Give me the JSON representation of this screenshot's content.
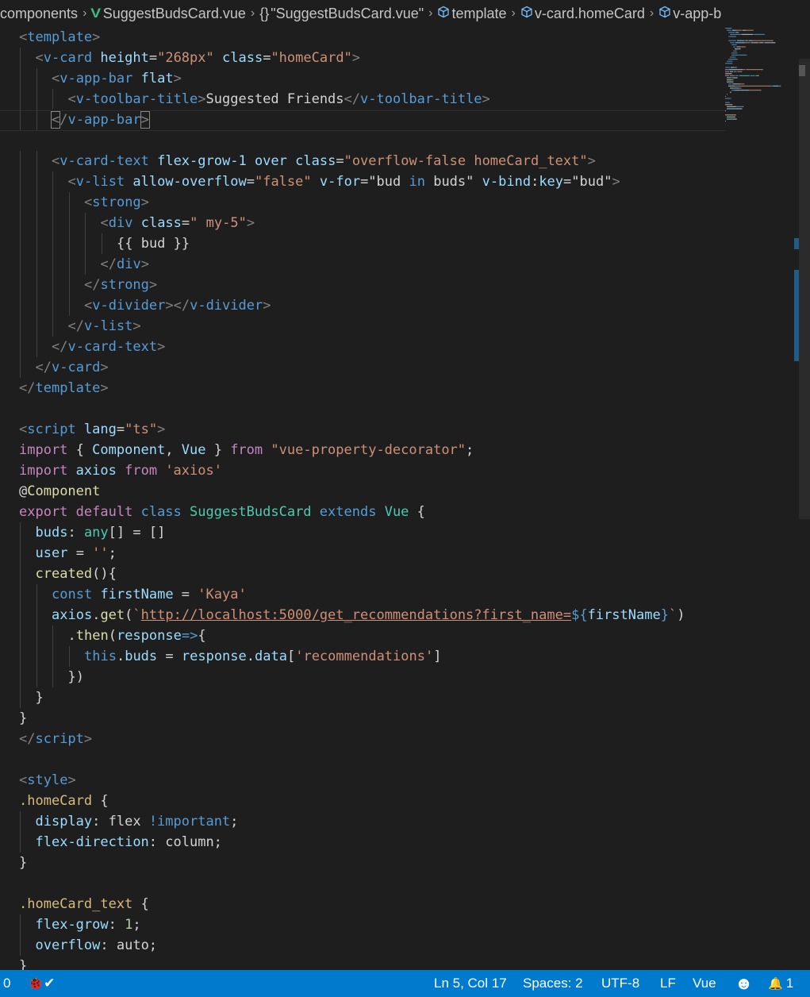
{
  "breadcrumb": {
    "items": [
      "components",
      "SuggestBudsCard.vue",
      "\"SuggestBudsCard.vue\"",
      "template",
      "v-card.homeCard",
      "v-app-b"
    ],
    "brace_glyph": "{}",
    "vue_glyph": "V",
    "chevron_glyph": "›",
    "icons": [
      "vue-file-icon",
      "braces-icon",
      "cube-icon",
      "cube-icon",
      "cube-icon"
    ]
  },
  "code_lines": [
    [
      [
        0,
        "tg",
        "<"
      ],
      [
        0,
        "tn",
        "template"
      ],
      [
        0,
        "tg",
        ">"
      ]
    ],
    [
      [
        1,
        "tg",
        "<"
      ],
      [
        1,
        "tn",
        "v-card"
      ],
      [
        1,
        "tx",
        " "
      ],
      [
        1,
        "at",
        "height"
      ],
      [
        1,
        "tx",
        "="
      ],
      [
        1,
        "sv",
        "\"268px\""
      ],
      [
        1,
        "tx",
        " "
      ],
      [
        1,
        "at",
        "class"
      ],
      [
        1,
        "tx",
        "="
      ],
      [
        1,
        "sv",
        "\"homeCard\""
      ],
      [
        1,
        "tg",
        ">"
      ]
    ],
    [
      [
        2,
        "tg",
        "<"
      ],
      [
        2,
        "tn",
        "v-app-bar"
      ],
      [
        2,
        "tx",
        " "
      ],
      [
        2,
        "at",
        "flat"
      ],
      [
        2,
        "tg",
        ">"
      ]
    ],
    [
      [
        3,
        "tg",
        "<"
      ],
      [
        3,
        "tn",
        "v-toolbar-title"
      ],
      [
        3,
        "tg",
        ">"
      ],
      [
        3,
        "tx",
        "Suggested Friends"
      ],
      [
        3,
        "tg",
        "</"
      ],
      [
        3,
        "tn",
        "v-toolbar-title"
      ],
      [
        3,
        "tg",
        ">"
      ]
    ],
    [
      [
        2,
        "tg bm",
        "<"
      ],
      [
        2,
        "tg",
        "/"
      ],
      [
        2,
        "tn",
        "v-app-bar"
      ],
      [
        2,
        "tg bm",
        ">"
      ]
    ],
    [],
    [
      [
        2,
        "tg",
        "<"
      ],
      [
        2,
        "tn",
        "v-card-text"
      ],
      [
        2,
        "tx",
        " "
      ],
      [
        2,
        "at",
        "flex-grow-1"
      ],
      [
        2,
        "tx",
        " "
      ],
      [
        2,
        "at",
        "over"
      ],
      [
        2,
        "tx",
        " "
      ],
      [
        2,
        "at",
        "class"
      ],
      [
        2,
        "tx",
        "="
      ],
      [
        2,
        "sv",
        "\"overflow-false homeCard_text\""
      ],
      [
        2,
        "tg",
        ">"
      ]
    ],
    [
      [
        3,
        "tg",
        "<"
      ],
      [
        3,
        "tn",
        "v-list"
      ],
      [
        3,
        "tx",
        " "
      ],
      [
        3,
        "at",
        "allow-overflow"
      ],
      [
        3,
        "tx",
        "="
      ],
      [
        3,
        "sv",
        "\"false\""
      ],
      [
        3,
        "tx",
        " "
      ],
      [
        3,
        "at",
        "v-for"
      ],
      [
        3,
        "tx",
        "=\"bud "
      ],
      [
        3,
        "kw",
        "in"
      ],
      [
        3,
        "tx",
        " buds\""
      ],
      [
        3,
        "tx",
        " "
      ],
      [
        3,
        "at",
        "v-bind"
      ],
      [
        3,
        "tx",
        ":"
      ],
      [
        3,
        "at",
        "key"
      ],
      [
        3,
        "tx",
        "=\"bud\""
      ],
      [
        3,
        "tg",
        ">"
      ]
    ],
    [
      [
        4,
        "tg",
        "<"
      ],
      [
        4,
        "tn",
        "strong"
      ],
      [
        4,
        "tg",
        ">"
      ]
    ],
    [
      [
        5,
        "tg",
        "<"
      ],
      [
        5,
        "tn",
        "div"
      ],
      [
        5,
        "tx",
        " "
      ],
      [
        5,
        "at",
        "class"
      ],
      [
        5,
        "tx",
        "="
      ],
      [
        5,
        "sv",
        "\" my-5\""
      ],
      [
        5,
        "tg",
        ">"
      ]
    ],
    [
      [
        6,
        "tx",
        "{{ bud }}"
      ]
    ],
    [
      [
        5,
        "tg",
        "</"
      ],
      [
        5,
        "tn",
        "div"
      ],
      [
        5,
        "tg",
        ">"
      ]
    ],
    [
      [
        4,
        "tg",
        "</"
      ],
      [
        4,
        "tn",
        "strong"
      ],
      [
        4,
        "tg",
        ">"
      ]
    ],
    [
      [
        4,
        "tg",
        "<"
      ],
      [
        4,
        "tn",
        "v-divider"
      ],
      [
        4,
        "tg",
        "></"
      ],
      [
        4,
        "tn",
        "v-divider"
      ],
      [
        4,
        "tg",
        ">"
      ]
    ],
    [
      [
        3,
        "tg",
        "</"
      ],
      [
        3,
        "tn",
        "v-list"
      ],
      [
        3,
        "tg",
        ">"
      ]
    ],
    [
      [
        2,
        "tg",
        "</"
      ],
      [
        2,
        "tn",
        "v-card-text"
      ],
      [
        2,
        "tg",
        ">"
      ]
    ],
    [
      [
        1,
        "tg",
        "</"
      ],
      [
        1,
        "tn",
        "v-card"
      ],
      [
        1,
        "tg",
        ">"
      ]
    ],
    [
      [
        0,
        "tg",
        "</"
      ],
      [
        0,
        "tn",
        "template"
      ],
      [
        0,
        "tg",
        ">"
      ]
    ],
    [],
    [
      [
        0,
        "tg",
        "<"
      ],
      [
        0,
        "tn",
        "script"
      ],
      [
        0,
        "tx",
        " "
      ],
      [
        0,
        "at",
        "lang"
      ],
      [
        0,
        "tx",
        "="
      ],
      [
        0,
        "sv",
        "\"ts\""
      ],
      [
        0,
        "tg",
        ">"
      ]
    ],
    [
      [
        0,
        "ctl",
        "import"
      ],
      [
        0,
        "tx",
        " { "
      ],
      [
        0,
        "vr",
        "Component"
      ],
      [
        0,
        "tx",
        ", "
      ],
      [
        0,
        "vr",
        "Vue"
      ],
      [
        0,
        "tx",
        " } "
      ],
      [
        0,
        "ctl",
        "from"
      ],
      [
        0,
        "tx",
        " "
      ],
      [
        0,
        "sv",
        "\"vue-property-decorator\""
      ],
      [
        0,
        "tx",
        ";"
      ]
    ],
    [
      [
        0,
        "ctl",
        "import"
      ],
      [
        0,
        "tx",
        " "
      ],
      [
        0,
        "vr",
        "axios"
      ],
      [
        0,
        "tx",
        " "
      ],
      [
        0,
        "ctl",
        "from"
      ],
      [
        0,
        "tx",
        " "
      ],
      [
        0,
        "sv",
        "'axios'"
      ]
    ],
    [
      [
        0,
        "tx",
        "@"
      ],
      [
        0,
        "fn",
        "Component"
      ]
    ],
    [
      [
        0,
        "ctl",
        "export"
      ],
      [
        0,
        "tx",
        " "
      ],
      [
        0,
        "ctl",
        "default"
      ],
      [
        0,
        "tx",
        " "
      ],
      [
        0,
        "kw",
        "class"
      ],
      [
        0,
        "tx",
        " "
      ],
      [
        0,
        "cls",
        "SuggestBudsCard"
      ],
      [
        0,
        "tx",
        " "
      ],
      [
        0,
        "kw",
        "extends"
      ],
      [
        0,
        "tx",
        " "
      ],
      [
        0,
        "cls",
        "Vue"
      ],
      [
        0,
        "tx",
        " {"
      ]
    ],
    [
      [
        1,
        "vr",
        "buds"
      ],
      [
        1,
        "tx",
        ": "
      ],
      [
        1,
        "cls",
        "any"
      ],
      [
        1,
        "tx",
        "[] = []"
      ]
    ],
    [
      [
        1,
        "vr",
        "user"
      ],
      [
        1,
        "tx",
        " = "
      ],
      [
        1,
        "sv",
        "''"
      ],
      [
        1,
        "tx",
        ";"
      ]
    ],
    [
      [
        1,
        "fn",
        "created"
      ],
      [
        1,
        "tx",
        "(){"
      ]
    ],
    [
      [
        2,
        "kw",
        "const"
      ],
      [
        2,
        "tx",
        " "
      ],
      [
        2,
        "vr",
        "firstName"
      ],
      [
        2,
        "tx",
        " = "
      ],
      [
        2,
        "sv",
        "'Kaya'"
      ]
    ],
    [
      [
        2,
        "vr",
        "axios"
      ],
      [
        2,
        "tx",
        "."
      ],
      [
        2,
        "fn",
        "get"
      ],
      [
        2,
        "tx",
        "("
      ],
      [
        2,
        "sv",
        "`"
      ],
      [
        2,
        "url",
        "http://localhost:5000/get_recommendations?first_name="
      ],
      [
        2,
        "tpl",
        "${"
      ],
      [
        2,
        "vr",
        "firstName"
      ],
      [
        2,
        "tpl",
        "}"
      ],
      [
        2,
        "sv",
        "`"
      ],
      [
        2,
        "tx",
        ")"
      ]
    ],
    [
      [
        3,
        "tx",
        "."
      ],
      [
        3,
        "fn",
        "then"
      ],
      [
        3,
        "tx",
        "("
      ],
      [
        3,
        "vr",
        "response"
      ],
      [
        3,
        "kw",
        "=>"
      ],
      [
        3,
        "tx",
        "{"
      ]
    ],
    [
      [
        4,
        "kw",
        "this"
      ],
      [
        4,
        "tx",
        "."
      ],
      [
        4,
        "vr",
        "buds"
      ],
      [
        4,
        "tx",
        " = "
      ],
      [
        4,
        "vr",
        "response"
      ],
      [
        4,
        "tx",
        "."
      ],
      [
        4,
        "vr",
        "data"
      ],
      [
        4,
        "tx",
        "["
      ],
      [
        4,
        "sv",
        "'recommendations'"
      ],
      [
        4,
        "tx",
        "]"
      ]
    ],
    [
      [
        3,
        "tx",
        "})"
      ]
    ],
    [
      [
        1,
        "tx",
        "}"
      ]
    ],
    [
      [
        0,
        "tx",
        "}"
      ]
    ],
    [
      [
        0,
        "tg",
        "</"
      ],
      [
        0,
        "tn",
        "script"
      ],
      [
        0,
        "tg",
        ">"
      ]
    ],
    [],
    [
      [
        0,
        "tg",
        "<"
      ],
      [
        0,
        "tn",
        "style"
      ],
      [
        0,
        "tg",
        ">"
      ]
    ],
    [
      [
        0,
        "sel",
        ".homeCard"
      ],
      [
        0,
        "tx",
        " {"
      ]
    ],
    [
      [
        1,
        "prop",
        "display"
      ],
      [
        1,
        "tx",
        ": flex "
      ],
      [
        1,
        "kw",
        "!important"
      ],
      [
        1,
        "tx",
        ";"
      ]
    ],
    [
      [
        1,
        "prop",
        "flex-direction"
      ],
      [
        1,
        "tx",
        ": column;"
      ]
    ],
    [
      [
        0,
        "tx",
        "}"
      ]
    ],
    [],
    [
      [
        0,
        "sel",
        ".homeCard_text"
      ],
      [
        0,
        "tx",
        " {"
      ]
    ],
    [
      [
        1,
        "prop",
        "flex-grow"
      ],
      [
        1,
        "tx",
        ": "
      ],
      [
        1,
        "num",
        "1"
      ],
      [
        1,
        "tx",
        ";"
      ]
    ],
    [
      [
        1,
        "prop",
        "overflow"
      ],
      [
        1,
        "tx",
        ": auto;"
      ]
    ],
    [
      [
        0,
        "tx",
        "}"
      ]
    ]
  ],
  "status": {
    "errors": "0",
    "position": "Ln 5, Col 17",
    "spaces": "Spaces: 2",
    "encoding": "UTF-8",
    "eol": "LF",
    "language": "Vue",
    "notifications": "1",
    "bug_glyph": "🐞✔",
    "smiley_glyph": "☻",
    "bell_glyph": "🔔"
  },
  "colors": {
    "editor_bg": "#1e1e1e",
    "status_bg": "#007acc",
    "vue_green": "#41b883"
  }
}
